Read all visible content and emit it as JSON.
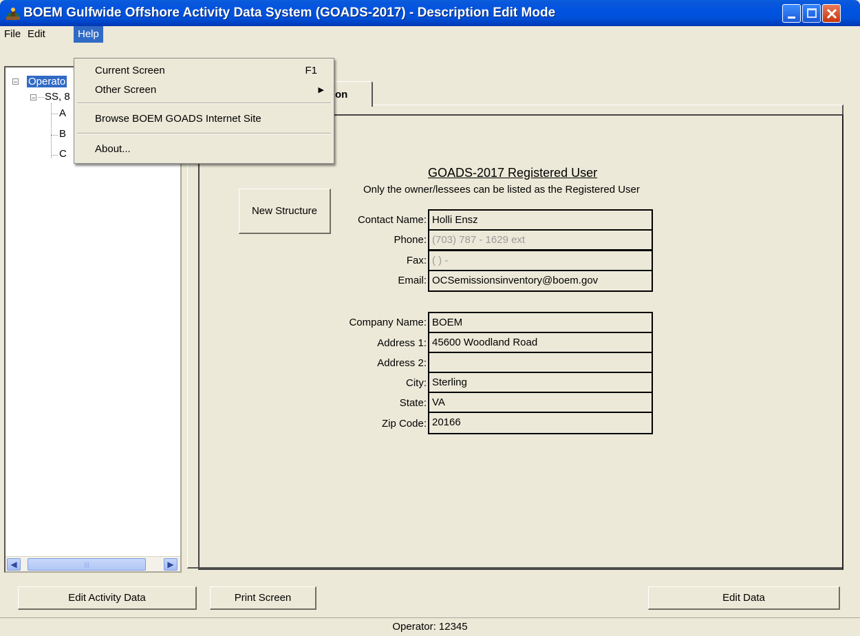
{
  "window": {
    "title": "BOEM Gulfwide Offshore Activity Data System (GOADS-2017) - Description Edit Mode"
  },
  "menubar": {
    "file": "File",
    "edit": "Edit",
    "help": "Help"
  },
  "help_menu": {
    "current_screen": "Current Screen",
    "current_screen_shortcut": "F1",
    "other_screen": "Other Screen",
    "browse_site": "Browse BOEM GOADS Internet Site",
    "about": "About..."
  },
  "tree": {
    "root": "Operato",
    "child": "SS, 8",
    "leaves": [
      "A",
      "B",
      "C"
    ]
  },
  "tab": {
    "label": "on"
  },
  "form": {
    "title": "GOADS-2017 Registered User",
    "subtitle": "Only the owner/lessees can be listed as the Registered User",
    "new_structure": "New Structure",
    "contact": {
      "contact_name_label": "Contact Name:",
      "contact_name": "Holli Ensz",
      "phone_label": "Phone:",
      "phone": "(703) 787 - 1629 ext",
      "fax_label": "Fax:",
      "fax": "(   )   -",
      "email_label": "Email:",
      "email": "OCSemissionsinventory@boem.gov"
    },
    "company": {
      "company_name_label": "Company Name:",
      "company_name": "BOEM",
      "address1_label": "Address 1:",
      "address1": "45600 Woodland Road",
      "address2_label": "Address 2:",
      "address2": "",
      "city_label": "City:",
      "city": "Sterling",
      "state_label": "State:",
      "state": "VA",
      "zip_label": "Zip Code:",
      "zip": "20166"
    }
  },
  "buttons": {
    "edit_activity": "Edit Activity Data",
    "print_screen": "Print Screen",
    "edit_data": "Edit Data"
  },
  "status": {
    "operator": "Operator: 12345"
  }
}
